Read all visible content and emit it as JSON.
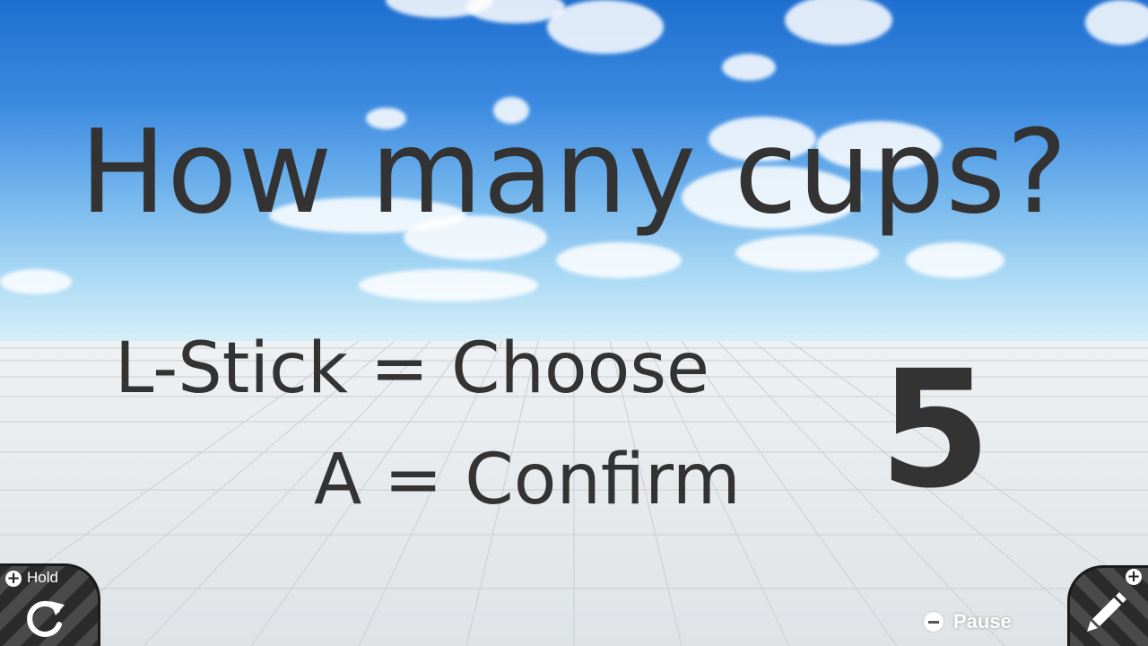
{
  "question": "How many cups?",
  "instructions": {
    "line1": "L-Stick = Choose",
    "line2": "A = Confirm"
  },
  "selected_count": "5",
  "controls": {
    "hold_label": "Hold",
    "pause_label": "Pause"
  },
  "icons": {
    "hold": "rotate-arrow-icon",
    "edit": "pencil-icon",
    "pause": "minus-button-icon",
    "plus": "plus-button-icon"
  },
  "colors": {
    "text": "#333333",
    "sky_top": "#1f6fd0",
    "floor": "#e4e7ea"
  }
}
